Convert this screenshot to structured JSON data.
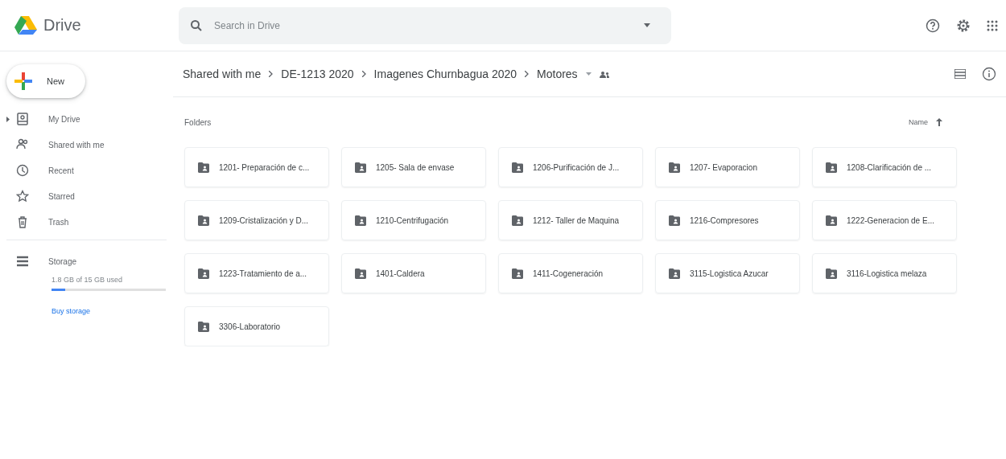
{
  "app": {
    "title": "Drive"
  },
  "search": {
    "placeholder": "Search in Drive"
  },
  "new_button": {
    "label": "New"
  },
  "sidebar": {
    "items": [
      {
        "label": "My Drive",
        "kind": "drive",
        "expandable": true
      },
      {
        "label": "Shared with me",
        "kind": "shared",
        "expandable": false
      },
      {
        "label": "Recent",
        "kind": "recent",
        "expandable": false
      },
      {
        "label": "Starred",
        "kind": "starred",
        "expandable": false
      },
      {
        "label": "Trash",
        "kind": "trash",
        "expandable": false
      }
    ]
  },
  "storage": {
    "label": "Storage",
    "usage": "1.8 GB of 15 GB used",
    "level": 0.12,
    "buy_link": "Buy storage"
  },
  "breadcrumb": [
    "Shared with me",
    "DE-1213 2020",
    "Imagenes Churnbagua 2020",
    "Motores"
  ],
  "section_label": "Folders",
  "sort": {
    "label": "Name"
  },
  "folders": [
    "1201- Preparación de c...",
    "1205- Sala de envase",
    "1206-Purificación de J...",
    "1207- Evaporacion",
    "1208-Clarificación de ...",
    "1209-Cristalización y D...",
    "1210-Centrifugación",
    "1212- Taller de Maquina",
    "1216-Compresores",
    "1222-Generacion de E...",
    "1223-Tratamiento de a...",
    "1401-Caldera",
    "1411-Cogeneración",
    "3115-Logistica Azucar",
    "3116-Logistica melaza",
    "3306-Laboratorio"
  ]
}
